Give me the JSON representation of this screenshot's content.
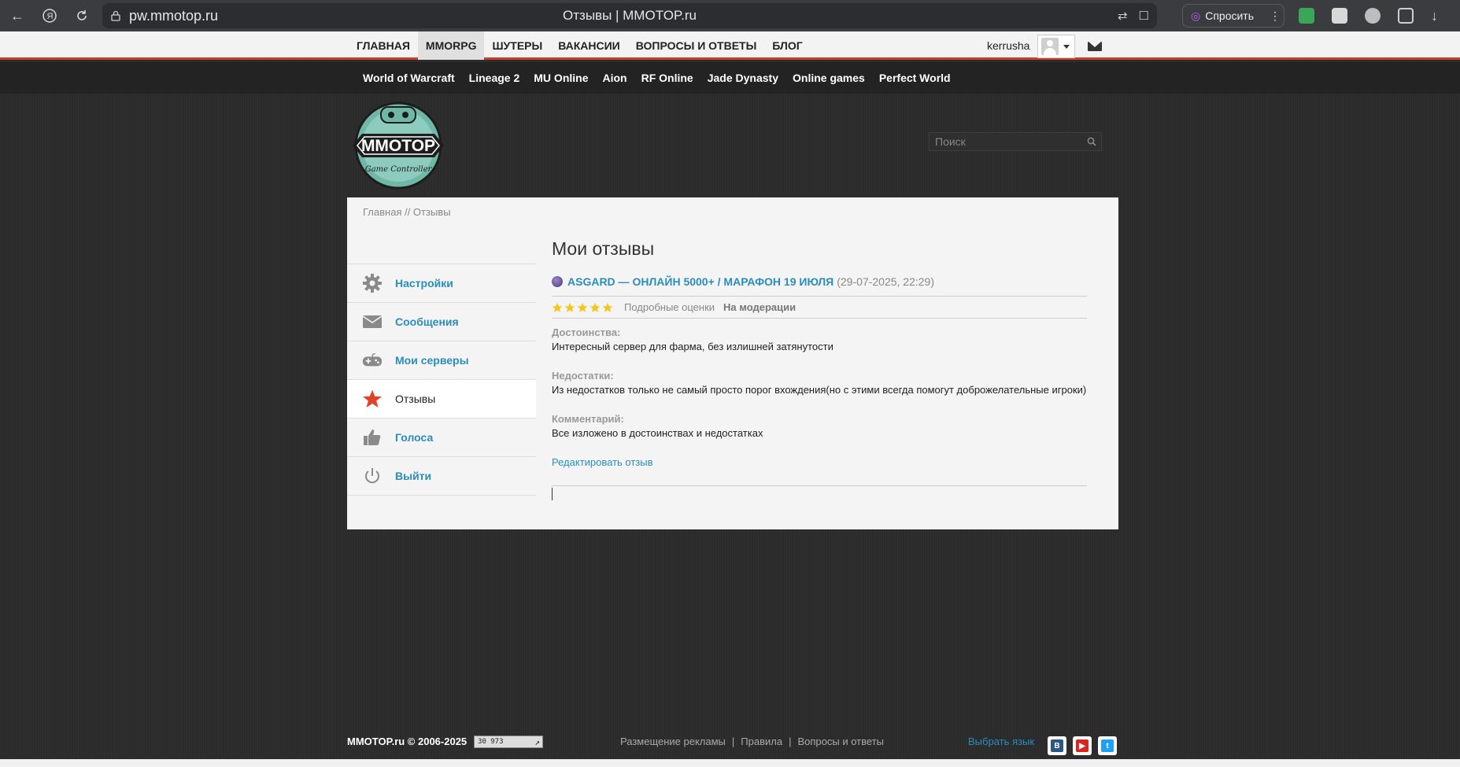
{
  "browser": {
    "url": "pw.mmotop.ru",
    "tab_title": "Отзывы | MMOTOP.ru",
    "ask_label": "Спросить"
  },
  "top_nav": {
    "items": [
      "ГЛАВНАЯ",
      "MMORPG",
      "ШУТЕРЫ",
      "ВАКАНСИИ",
      "ВОПРОСЫ И ОТВЕТЫ",
      "БЛОГ"
    ],
    "active_index": 1,
    "username": "kerrusha"
  },
  "games_nav": {
    "items": [
      "World of Warcraft",
      "Lineage 2",
      "MU Online",
      "Aion",
      "RF Online",
      "Jade Dynasty",
      "Online games",
      "Perfect World"
    ]
  },
  "logo": {
    "text": "MMOTOP",
    "subtext": "Game Controller"
  },
  "search": {
    "placeholder": "Поиск"
  },
  "breadcrumb": "Главная // Отзывы",
  "sidebar": {
    "items": [
      {
        "label": "Настройки",
        "icon": "gear-icon"
      },
      {
        "label": "Сообщения",
        "icon": "envelope-icon"
      },
      {
        "label": "Мои серверы",
        "icon": "gamepad-icon"
      },
      {
        "label": "Отзывы",
        "icon": "star-icon",
        "active": true
      },
      {
        "label": "Голоса",
        "icon": "thumbs-up-icon"
      },
      {
        "label": "Выйти",
        "icon": "power-icon"
      }
    ]
  },
  "content": {
    "title": "Мои отзывы",
    "review": {
      "server_name": "ASGARD — ОНЛАЙН 5000+ / МАРАФОН 19 ИЮЛЯ",
      "date": "(29-07-2025, 22:29)",
      "stars": 5,
      "detail_link": "Подробные оценки",
      "status": "На модерации",
      "pros_label": "Достоинства:",
      "pros_text": "Интересный сервер для фарма, без излишней затянутости",
      "cons_label": "Недостатки:",
      "cons_text": "Из недостатков только не самый просто порог вхождения(но с этими всегда помогут доброжелательные игроки)",
      "comment_label": "Комментарий:",
      "comment_text": "Все изложено в достоинствах и недостатках",
      "edit_link": "Редактировать отзыв"
    }
  },
  "footer": {
    "copyright": "MMOTOP.ru © 2006-2025",
    "counter": "30 973",
    "links": [
      "Размещение рекламы",
      "Правила",
      "Вопросы и ответы"
    ],
    "separator": "|",
    "language": "Выбрать язык",
    "social": [
      {
        "name": "vk",
        "glyph": "В",
        "color": "#2a5885"
      },
      {
        "name": "youtube",
        "glyph": "▶",
        "color": "#d9261c"
      },
      {
        "name": "twitter",
        "glyph": "t",
        "color": "#1da1f2"
      }
    ]
  },
  "colors": {
    "accent": "#2a8dbb",
    "nav_border": "#c7402b",
    "star": "#f5c518",
    "active_star": "#e0432a"
  }
}
